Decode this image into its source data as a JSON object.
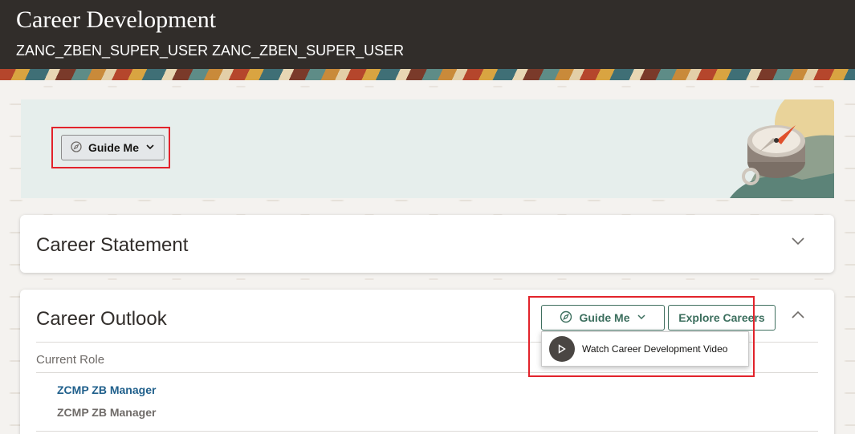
{
  "header": {
    "title": "Career Development",
    "subtitle": "ZANC_ZBEN_SUPER_USER ZANC_ZBEN_SUPER_USER"
  },
  "banner": {
    "guide_me_label": "Guide Me",
    "icon": "compass-icon"
  },
  "career_statement": {
    "title": "Career Statement",
    "expand_icon": "chevron-down-icon"
  },
  "career_outlook": {
    "title": "Career Outlook",
    "guide_me_label": "Guide Me",
    "explore_label": "Explore Careers",
    "collapse_icon": "chevron-up-icon",
    "guide_menu": {
      "items": [
        {
          "label": "Watch Career Development Video",
          "icon": "play-icon"
        }
      ]
    },
    "current_role_label": "Current Role",
    "current_role": {
      "title": "ZCMP ZB Manager",
      "subtitle": "ZCMP ZB Manager"
    }
  },
  "colors": {
    "header_bg": "#312d2a",
    "banner_bg": "#e6eeec",
    "accent_green": "#3b6e5d",
    "link_blue": "#1f5f8b",
    "highlight_red": "#e2232b"
  }
}
